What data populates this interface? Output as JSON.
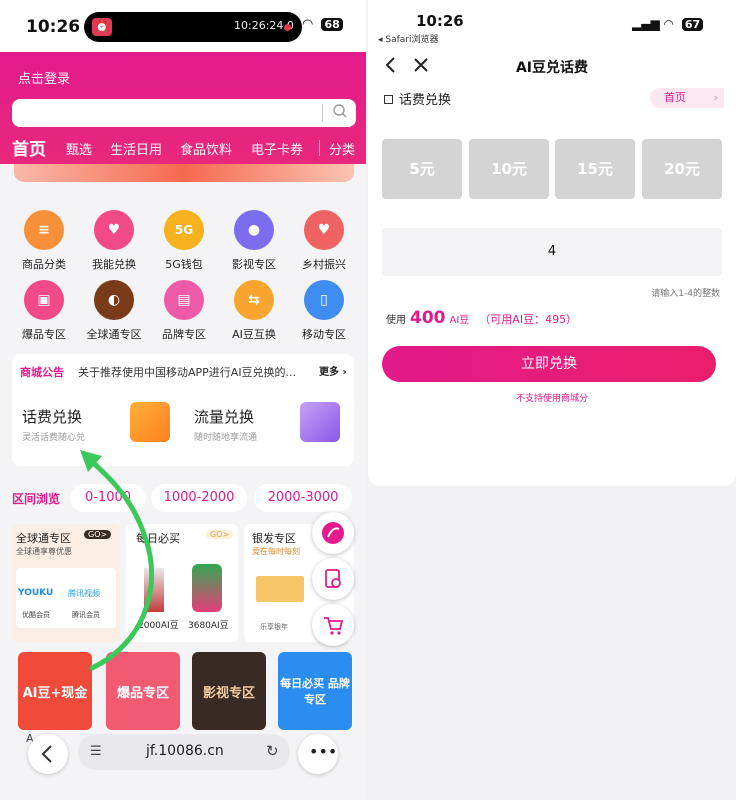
{
  "left": {
    "status": {
      "time": "10:26",
      "recording_time": "10:26:24.0",
      "battery": "68"
    },
    "header": {
      "login": "点击登录",
      "tabs": [
        "首页",
        "甄选",
        "生活日用",
        "食品饮料",
        "电子卡券",
        "分类"
      ]
    },
    "icons_row1": [
      {
        "label": "商品分类",
        "color": "#f6913a",
        "glyph": "≡"
      },
      {
        "label": "我能兑换",
        "color": "#f24a86",
        "glyph": "♥"
      },
      {
        "label": "5G钱包",
        "color": "#f7b21d",
        "glyph": "5G"
      },
      {
        "label": "影视专区",
        "color": "#7b6cf0",
        "glyph": "●"
      },
      {
        "label": "乡村振兴",
        "color": "#f06363",
        "glyph": "♥"
      }
    ],
    "icons_row2": [
      {
        "label": "爆品专区",
        "color": "#f24a86",
        "glyph": "▣"
      },
      {
        "label": "全球通专区",
        "color": "#7a3b1b",
        "glyph": "◐"
      },
      {
        "label": "品牌专区",
        "color": "#ec5aa8",
        "glyph": "▤"
      },
      {
        "label": "AI豆互换",
        "color": "#f8a42e",
        "glyph": "⇆"
      },
      {
        "label": "移动专区",
        "color": "#3f8df2",
        "glyph": "▯"
      }
    ],
    "notice": {
      "label": "商城公告",
      "text": "关于推荐使用中国移动APP进行AI豆兑换的...",
      "more": "更多"
    },
    "exchange": [
      {
        "title": "话费兑换",
        "sub": "灵活话费随心兑"
      },
      {
        "title": "流量兑换",
        "sub": "随时随地享流通"
      }
    ],
    "price_section": {
      "title": "区间浏览",
      "ranges": [
        "0-1000",
        "1000-2000",
        "2000-3000"
      ]
    },
    "products": {
      "global": {
        "title": "全球通专区",
        "sub": "全球通享尊优惠",
        "go": "GO>",
        "brand1": "YOUKU",
        "brand2": "腾讯视频",
        "cap1": "优酷会员",
        "cap2": "腾讯会员"
      },
      "daily": {
        "title": "每日必买",
        "go": "GO>",
        "price1": "2000AI豆",
        "price2": "3680AI豆"
      },
      "silver": {
        "title": "银发专区",
        "sub": "爱在每时每刻",
        "cap": "乐享银年"
      }
    },
    "bottom_cards": [
      {
        "label": "AI豆+现金",
        "color": "#f04a3a"
      },
      {
        "label": "爆品专区",
        "color": "#f25a72"
      },
      {
        "label": "影视专区",
        "color": "#3a2a24"
      },
      {
        "label": "每日必买 品牌专区",
        "color": "#2c8df0"
      }
    ],
    "bottom_caption": "A",
    "url": "jf.10086.cn"
  },
  "right": {
    "status": {
      "time": "10:26",
      "back_app": "◂ Safari浏览器",
      "battery": "67"
    },
    "title": "AI豆兑话费",
    "section": "话费兑换",
    "home": "首页",
    "denominations": [
      "5元",
      "10元",
      "15元",
      "20元"
    ],
    "quantity": "4",
    "hint": "请输入1-4的整数",
    "use_prefix": "使用",
    "use_amount": "400",
    "use_unit": "AI豆",
    "available": "（可用AI豆：495）",
    "redeem": "立即兑换",
    "unsupported": "不支持使用商城分"
  },
  "colors": {
    "brand": "#e31a8c",
    "arrow": "#3cc85a"
  }
}
